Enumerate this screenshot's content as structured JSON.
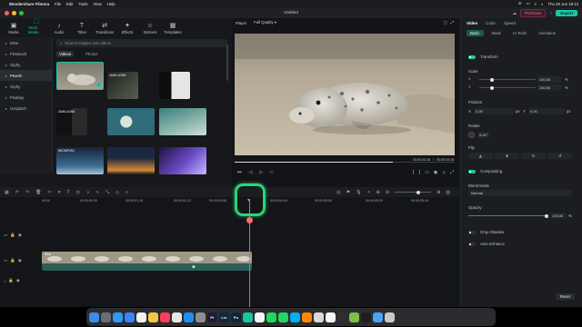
{
  "menubar": {
    "apple_icon": "apple-icon",
    "app_name": "Wondershare Filmora",
    "items": [
      "File",
      "Edit",
      "Tools",
      "View",
      "Help"
    ],
    "clock": "Thu 29 Jun 18:13"
  },
  "window": {
    "title": "Untitled",
    "purchase_label": "Purchase",
    "export_label": "Export"
  },
  "toolbar": [
    {
      "label": "Media",
      "icon": "media-icon"
    },
    {
      "label": "Stock Media",
      "icon": "stock-media-icon",
      "active": true
    },
    {
      "label": "Audio",
      "icon": "audio-icon"
    },
    {
      "label": "Titles",
      "icon": "titles-icon"
    },
    {
      "label": "Transitions",
      "icon": "transitions-icon"
    },
    {
      "label": "Effects",
      "icon": "effects-icon"
    },
    {
      "label": "Stickers",
      "icon": "stickers-icon"
    },
    {
      "label": "Templates",
      "icon": "templates-icon"
    }
  ],
  "sidebar": {
    "items": [
      {
        "label": "Mine"
      },
      {
        "label": "Filmstock"
      },
      {
        "label": "Giphy"
      },
      {
        "label": "Pexels",
        "active": true
      },
      {
        "label": "Giphy"
      },
      {
        "label": "Pixabay"
      },
      {
        "label": "Unsplash"
      }
    ]
  },
  "media": {
    "search_placeholder": "Search images and videos",
    "tabs": [
      {
        "label": "Videos",
        "active": true
      },
      {
        "label": "Photos"
      }
    ],
    "thumbs": [
      {
        "label": "",
        "palette": [
          "#6b6a66",
          "#8f8a7c"
        ]
      },
      {
        "label": "21MILLIONS",
        "palette": [
          "#2a2e2a",
          "#4f5a4c"
        ]
      },
      {
        "label": "",
        "palette": [
          "#111",
          "#d7d7d7"
        ]
      },
      {
        "label": "21MILLIONS",
        "palette": [
          "#1a1a1a",
          "#2d2d2d"
        ]
      },
      {
        "label": "",
        "palette": [
          "#2f6b78",
          "#7ea7a8"
        ]
      },
      {
        "label": "",
        "palette": [
          "#3a7f7d",
          "#8fb7ad"
        ]
      },
      {
        "label": "NEONPDSC",
        "palette": [
          "#16243a",
          "#3f6d93"
        ]
      },
      {
        "label": "",
        "palette": [
          "#1c2840",
          "#d48a3b"
        ]
      },
      {
        "label": "",
        "palette": [
          "#20123c",
          "#6a4bc4"
        ]
      }
    ]
  },
  "player": {
    "player_label": "Player",
    "quality": "Full Quality",
    "current_time": "00:00:03:18",
    "total_time": "00:00:03:18",
    "progress": 0.72
  },
  "properties": {
    "tabs": [
      {
        "label": "Video",
        "active": true
      },
      {
        "label": "Color"
      },
      {
        "label": "Speed"
      }
    ],
    "subtabs": [
      {
        "label": "Basic",
        "active": true
      },
      {
        "label": "Mask"
      },
      {
        "label": "AI Tools"
      },
      {
        "label": "Animation"
      }
    ],
    "transform_label": "Transform",
    "scale_label": "Scale",
    "scale_x": "100,00",
    "scale_y": "100,00",
    "scale_unit": "%",
    "position_label": "Position",
    "pos_x_label": "X",
    "pos_x": "0,00",
    "pos_y_label": "Y",
    "pos_y": "0,00",
    "pos_unit": "px",
    "rotate_label": "Rotate",
    "rotate_value": "0,00°",
    "flip_label": "Flip",
    "compositing_label": "Compositing",
    "blend_label": "Blend Mode",
    "blend_value": "Normal",
    "opacity_label": "Opacity",
    "opacity_value": "100,00",
    "drop_shadow_label": "Drop Shadow",
    "auto_enhance_label": "Auto Enhance",
    "reset_label": "Reset"
  },
  "timeline": {
    "ruler": [
      "00:00",
      "00:00:00:20",
      "00:00:01:16",
      "00:00:02:12",
      "00:00:03:08",
      "00:00:04:04",
      "00:00:05:00",
      "00:00:05:20",
      "00:00:06:16"
    ],
    "clip_label": "Seal",
    "track_icons": [
      "video-track-icon",
      "audio-track-icon"
    ]
  },
  "dock": {
    "apps": [
      {
        "name": "finder-icon",
        "color": "#3a8ee6",
        "glyph": ""
      },
      {
        "name": "launchpad-icon",
        "color": "#6a6d74",
        "glyph": ""
      },
      {
        "name": "safari-icon",
        "color": "#2b9bf0",
        "glyph": ""
      },
      {
        "name": "mail-icon",
        "color": "#3b82f6",
        "glyph": ""
      },
      {
        "name": "calendar-icon",
        "color": "#f2f2f2",
        "glyph": ""
      },
      {
        "name": "notes-icon",
        "color": "#f3c843",
        "glyph": ""
      },
      {
        "name": "music-icon",
        "color": "#fa3e5b",
        "glyph": ""
      },
      {
        "name": "photos-icon",
        "color": "#e8e8e8",
        "glyph": ""
      },
      {
        "name": "app-store-icon",
        "color": "#1d8ff2",
        "glyph": ""
      },
      {
        "name": "system-settings-icon",
        "color": "#8e8e93",
        "glyph": ""
      },
      {
        "name": "premiere-icon",
        "color": "#1f1a3d",
        "glyph": "Pr"
      },
      {
        "name": "lightroom-classic-icon",
        "color": "#0b2a3c",
        "glyph": "Lrc"
      },
      {
        "name": "photoshop-icon",
        "color": "#0b2641",
        "glyph": "Ps"
      },
      {
        "name": "filmora-icon",
        "color": "#16c7a2",
        "glyph": ""
      },
      {
        "name": "chrome-icon",
        "color": "#f4f4f4",
        "glyph": ""
      },
      {
        "name": "spotify-icon",
        "color": "#1ed760",
        "glyph": ""
      },
      {
        "name": "whatsapp-icon",
        "color": "#25d366",
        "glyph": ""
      },
      {
        "name": "skype-icon",
        "color": "#00aff0",
        "glyph": ""
      },
      {
        "name": "vlc-icon",
        "color": "#ff8800",
        "glyph": ""
      },
      {
        "name": "preview-icon",
        "color": "#d9d9d9",
        "glyph": ""
      },
      {
        "name": "textedit-icon",
        "color": "#f6f6f6",
        "glyph": ""
      },
      {
        "name": "activity-monitor-icon",
        "color": "#2e2e2e",
        "glyph": ""
      },
      {
        "name": "utorrent-icon",
        "color": "#7cc043",
        "glyph": ""
      },
      {
        "name": "terminal-icon",
        "color": "#1e1e1e",
        "glyph": ""
      },
      {
        "name": "folder-icon",
        "color": "#4aa3f0",
        "glyph": ""
      },
      {
        "name": "trash-icon",
        "color": "#c9c9c9",
        "glyph": ""
      }
    ]
  },
  "colors": {
    "accent": "#19c7a4",
    "playhead": "#ff5b5b",
    "highlight_ring": "#27d67a"
  }
}
